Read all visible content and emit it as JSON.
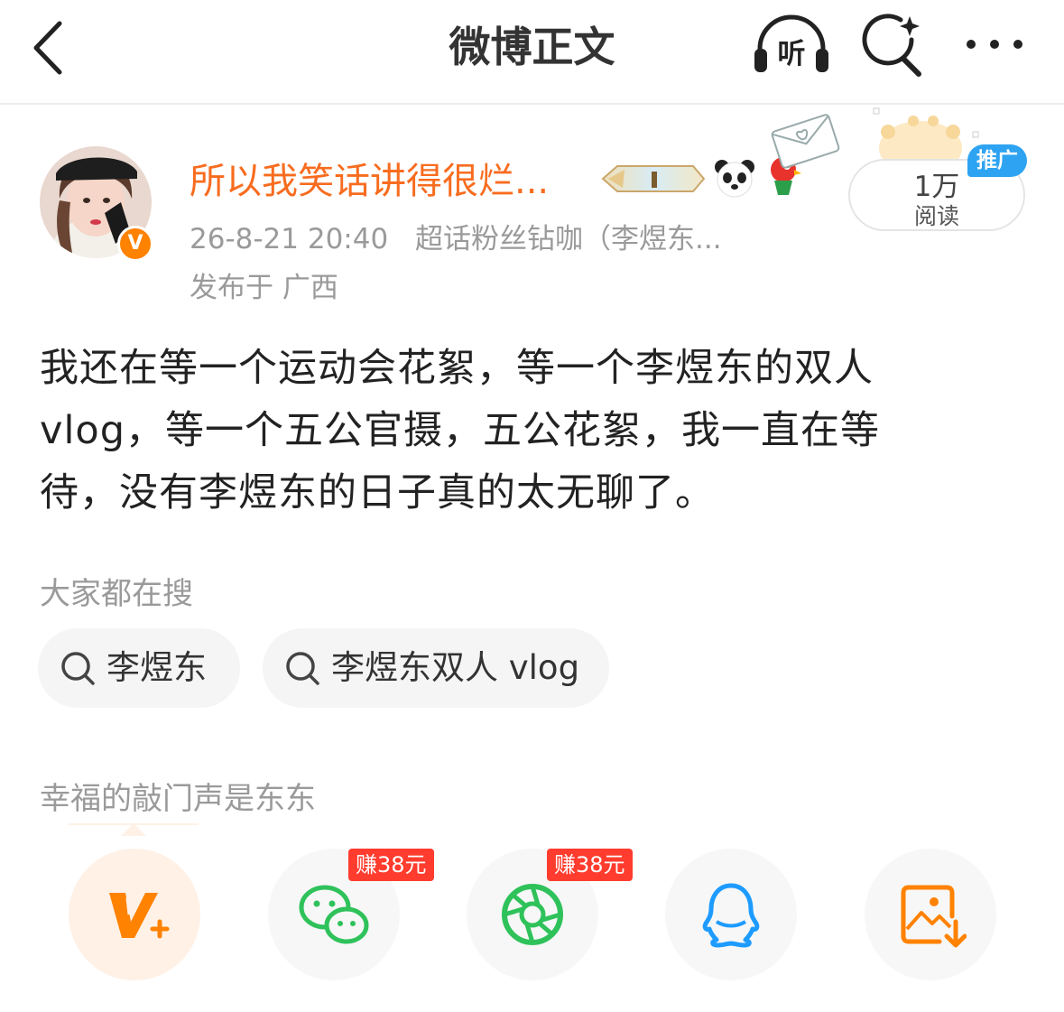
{
  "header": {
    "title": "微博正文",
    "listen_label": "听",
    "icons": [
      "back-chevron-icon",
      "headphones-icon",
      "search-sparkle-icon",
      "more-dots-icon"
    ]
  },
  "author": {
    "name": "所以我笑话讲得很烂...",
    "verified_badge": "V",
    "timestamp": "26-8-21 20:40",
    "source": "超话粉丝钻咖（李煜东...",
    "location": "发布于 广西",
    "badges": [
      "medal-badge-icon",
      "panda-emoji-icon",
      "bird-emoji-icon"
    ]
  },
  "read_count": {
    "value": "1万",
    "label": "阅读",
    "ad_tag": "推广"
  },
  "post": {
    "text": "我还在等一个运动会花絮，等一个李煜东的双人vlog，等一个五公官摄，五公花絮，我一直在等待，没有李煜东的日子真的太无聊了。"
  },
  "search_suggestions": {
    "label": "大家都在搜",
    "items": [
      {
        "text": "李煜东"
      },
      {
        "text": "李煜东双人 vlog"
      }
    ]
  },
  "topic": "幸福的敲门声是东东",
  "share": {
    "items": [
      {
        "icon": "v-plus-icon",
        "color": "#ff8200"
      },
      {
        "icon": "wechat-icon",
        "color": "#2fc25b",
        "badge": "赚38元"
      },
      {
        "icon": "moments-icon",
        "color": "#2fc25b",
        "badge": "赚38元"
      },
      {
        "icon": "qq-icon",
        "color": "#1e9bff"
      },
      {
        "icon": "save-image-icon",
        "color": "#ff8200"
      }
    ]
  },
  "colors": {
    "accent": "#f86c1f",
    "muted": "#9a9a9a",
    "ad_blue": "#2ea3f2",
    "earn_red": "#ff3c2e"
  }
}
